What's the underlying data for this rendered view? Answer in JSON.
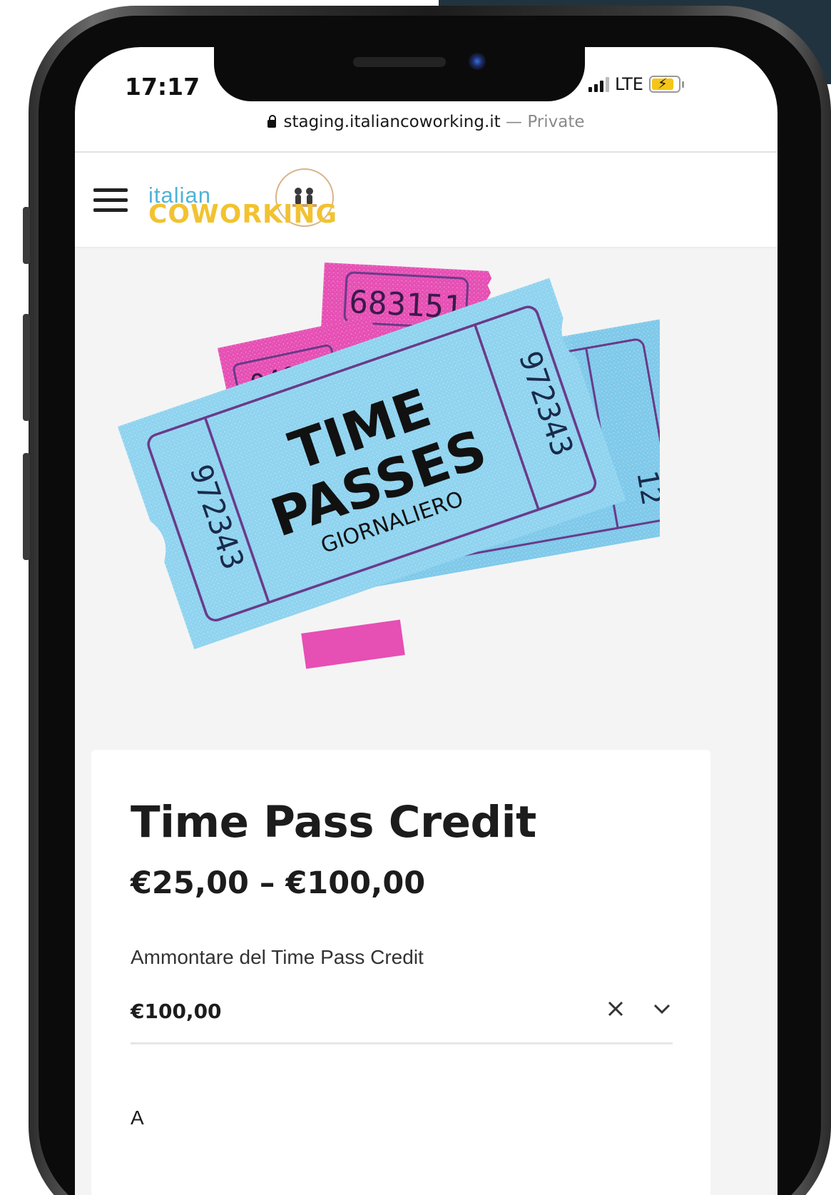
{
  "status_bar": {
    "time": "17:17",
    "network": "LTE"
  },
  "browser": {
    "url": "staging.italiancoworking.it",
    "separator": " — ",
    "mode": "Private"
  },
  "header": {
    "logo_top": "italian",
    "logo_bottom": "COWORKING"
  },
  "hero_image": {
    "pink_ticket_number": "683151",
    "pink_ticket_number_2": "0401",
    "blue_ticket_number": "972343",
    "back_ticket_number": "12",
    "headline_1": "TIME",
    "headline_2": "PASSES",
    "subline": "GIORNALIERO"
  },
  "product": {
    "title": "Time Pass Credit",
    "price_range": "€25,00 – €100,00",
    "amount_label": "Ammontare del Time Pass Credit",
    "amount_selected": "€100,00",
    "next_field_label": "A"
  },
  "colors": {
    "accent_blue": "#4fb3d6",
    "accent_yellow": "#f2c230",
    "ticket_blue": "#8fd3ef",
    "ticket_pink": "#e64fb4",
    "ticket_line": "#6a3a8a"
  }
}
